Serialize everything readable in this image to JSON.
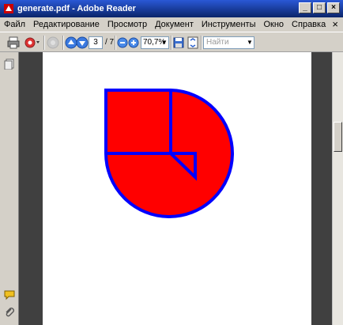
{
  "window": {
    "title": "generate.pdf - Adobe Reader"
  },
  "menubar": {
    "items": [
      "Файл",
      "Редактирование",
      "Просмотр",
      "Документ",
      "Инструменты",
      "Окно",
      "Справка"
    ],
    "close_glyph": "×"
  },
  "toolbar": {
    "icons": [
      "print-icon",
      "share-icon",
      "disabled-icon",
      "page-up-icon",
      "page-down-icon",
      "zoom-out-icon",
      "zoom-in-icon",
      "save-icon",
      "fit-page-icon"
    ],
    "page_value": "3",
    "page_total": "/ 7",
    "zoom_value": "70,7%",
    "search_placeholder": "Найти"
  },
  "nav": {
    "icons": [
      "pages-icon",
      "comment-icon",
      "attachment-icon"
    ]
  },
  "document": {
    "shape": {
      "fill": "#ff0000",
      "stroke": "#0000ff"
    }
  }
}
